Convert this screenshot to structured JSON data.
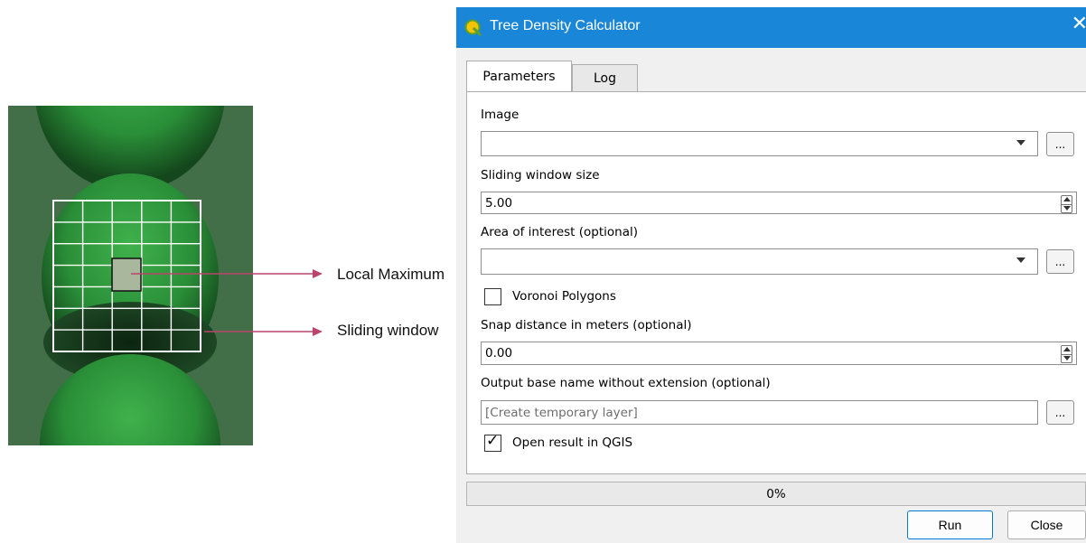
{
  "illustration": {
    "labels": {
      "local_maximum": "Local Maximum",
      "sliding_window": "Sliding window"
    },
    "colors": {
      "background": "#426e48",
      "tree_crown": "#2f9a3c",
      "grid": "#ffffff",
      "maximum_cell": "#a9b89c",
      "arrow": "#b9456b"
    }
  },
  "dialog": {
    "title": "Tree Density Calculator",
    "app_icon": "qgis-logo-icon",
    "close_icon": "close-icon",
    "tabs": [
      {
        "label": "Parameters",
        "active": true
      },
      {
        "label": "Log",
        "active": false
      }
    ],
    "parameters": {
      "image": {
        "label": "Image",
        "value": ""
      },
      "sliding_window_size": {
        "label": "Sliding window size",
        "value": "5.00"
      },
      "area_of_interest": {
        "label": "Area of interest (optional)",
        "value": ""
      },
      "voronoi": {
        "label": "Voronoi Polygons",
        "checked": false
      },
      "snap_distance": {
        "label": "Snap distance in meters (optional)",
        "value": "0.00"
      },
      "output_base_name": {
        "label": "Output base name without extension (optional)",
        "placeholder": "[Create temporary layer]",
        "value": ""
      },
      "open_result": {
        "label": "Open result in QGIS",
        "checked": true
      }
    },
    "browse_label": "...",
    "progress": {
      "text": "0%",
      "value": 0
    },
    "buttons": {
      "run": "Run",
      "close": "Close"
    },
    "colors": {
      "titlebar": "#1a86d8",
      "run_border": "#0078d7"
    }
  }
}
